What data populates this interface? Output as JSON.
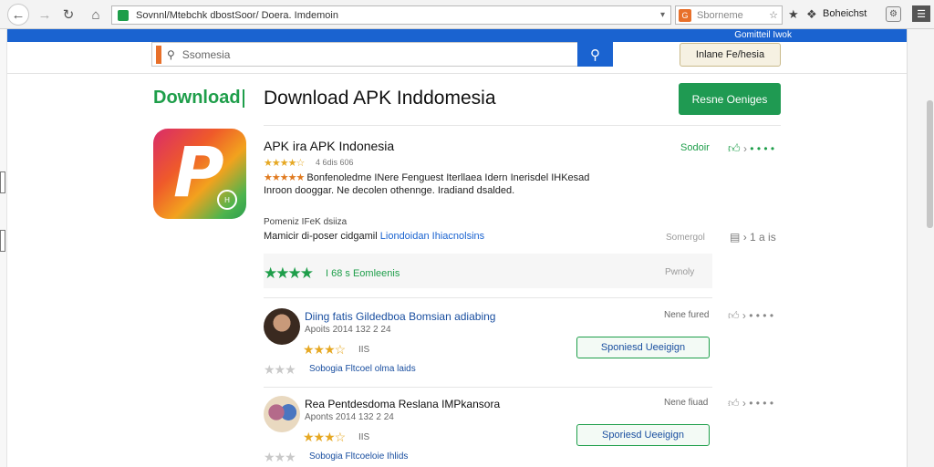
{
  "browser": {
    "url": "Sovnnl/Mtebchk dbostSoor/ Doera. Imdemoin",
    "search_placeholder": "Sborneme",
    "bookmark_label": "Boheichst"
  },
  "site": {
    "top_link": "Gomitteil Iwok",
    "search_placeholder": "Ssomesia",
    "header_button": "Inlane Fe/hesia",
    "brand": "Download",
    "page_title": "Download APK Inddomesia",
    "primary_button": "Resne Oeniges"
  },
  "app": {
    "name": "APK ira APK Indonesia",
    "stars": "★★★★☆",
    "count": "4  6dis 606",
    "desc_stars": "★★★★★",
    "desc_line1": "Bonfenoledme INere Fenguest Iterllaea Idern Inerisdel IHKesad",
    "desc_line2": "Inroon dooggar. Ne decolen othennge. Iradiand dsalded.",
    "status_link": "Sodoir",
    "badge": "H"
  },
  "section": {
    "label": "Pomeniz IFeK dsiiza",
    "text": "Mamicir di-poser cidgamil",
    "link": "Liondoidan Ihiacnolsins",
    "right": "Somergol",
    "right_count": "1 a is"
  },
  "rating": {
    "stars": "★★★★",
    "count": "I 68 s Eomleenis",
    "right": "Pwnoly"
  },
  "reviews": [
    {
      "title": "Diing fatis Gildedboa Bomsian adiabing",
      "date": "Apoits 2014 132 2 24",
      "stars": "★★★☆",
      "count": "IIS",
      "button": "Sponiesd Ueeigign",
      "gray_stars": "★★★",
      "foot": "Sobogia Fltcoel olma laids",
      "right": "Nene fured"
    },
    {
      "title": "Rea Pentdesdoma Reslana IMPkansora",
      "date": "Aponts 2014 132 2 24",
      "stars": "★★★☆",
      "count": "IIS",
      "button": "Sporiesd Ueeigign",
      "gray_stars": "★★★",
      "foot": "Sobogia Fltcoeloie Ihlids",
      "right": "Nene fiuad"
    }
  ],
  "actions": {
    "dots": "• • • •",
    "arrow": "›"
  }
}
